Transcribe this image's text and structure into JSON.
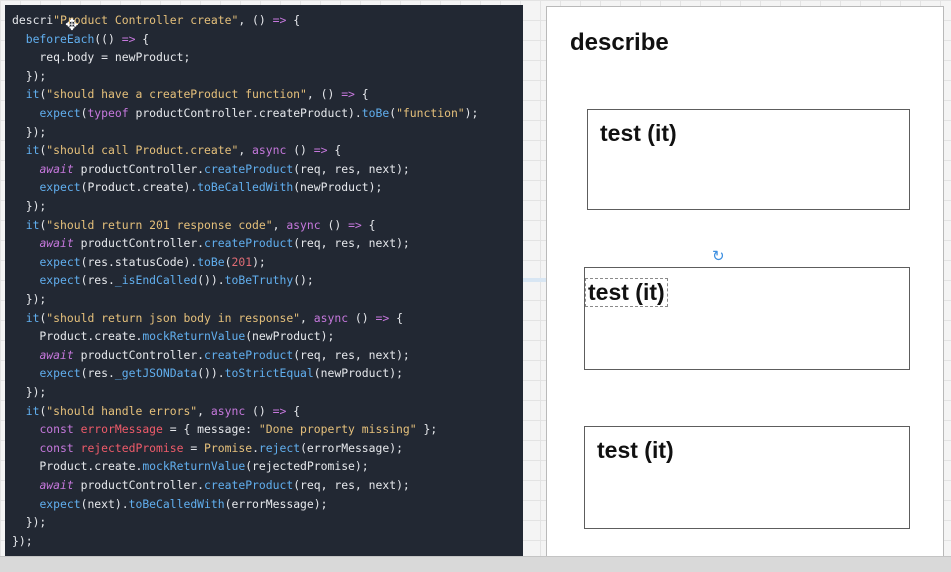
{
  "code": {
    "lines": [
      [
        [
          "pl",
          "descri"
        ],
        [
          "str",
          "\"Product Controller create\""
        ],
        [
          "pl",
          ", () "
        ],
        [
          "kw",
          "=>"
        ],
        [
          "pl",
          " {"
        ]
      ],
      [
        [
          "pl",
          "  "
        ],
        [
          "fn",
          "beforeEach"
        ],
        [
          "pl",
          "(() "
        ],
        [
          "kw",
          "=>"
        ],
        [
          "pl",
          " {"
        ]
      ],
      [
        [
          "pl",
          "    req.body = newProduct;"
        ]
      ],
      [
        [
          "pl",
          "  });"
        ]
      ],
      [
        [
          "pl",
          "  "
        ],
        [
          "fn",
          "it"
        ],
        [
          "pl",
          "("
        ],
        [
          "str",
          "\"should have a createProduct function\""
        ],
        [
          "pl",
          ", () "
        ],
        [
          "kw",
          "=>"
        ],
        [
          "pl",
          " {"
        ]
      ],
      [
        [
          "pl",
          "    "
        ],
        [
          "fn",
          "expect"
        ],
        [
          "pl",
          "("
        ],
        [
          "kw",
          "typeof"
        ],
        [
          "pl",
          " productController.createProduct)."
        ],
        [
          "fn",
          "toBe"
        ],
        [
          "pl",
          "("
        ],
        [
          "str",
          "\"function\""
        ],
        [
          "pl",
          ");"
        ]
      ],
      [
        [
          "pl",
          "  });"
        ]
      ],
      [
        [
          "pl",
          "  "
        ],
        [
          "fn",
          "it"
        ],
        [
          "pl",
          "("
        ],
        [
          "str",
          "\"should call Product.create\""
        ],
        [
          "pl",
          ", "
        ],
        [
          "kw",
          "async"
        ],
        [
          "pl",
          " () "
        ],
        [
          "kw",
          "=>"
        ],
        [
          "pl",
          " {"
        ]
      ],
      [
        [
          "pl",
          "    "
        ],
        [
          "ital",
          "await"
        ],
        [
          "pl",
          " productController."
        ],
        [
          "fn",
          "createProduct"
        ],
        [
          "pl",
          "(req, res, next);"
        ]
      ],
      [
        [
          "pl",
          "    "
        ],
        [
          "fn",
          "expect"
        ],
        [
          "pl",
          "(Product.create)."
        ],
        [
          "fn",
          "toBeCalledWith"
        ],
        [
          "pl",
          "(newProduct);"
        ]
      ],
      [
        [
          "pl",
          "  });"
        ]
      ],
      [
        [
          "pl",
          "  "
        ],
        [
          "fn",
          "it"
        ],
        [
          "pl",
          "("
        ],
        [
          "str",
          "\"should return 201 response code\""
        ],
        [
          "pl",
          ", "
        ],
        [
          "kw",
          "async"
        ],
        [
          "pl",
          " () "
        ],
        [
          "kw",
          "=>"
        ],
        [
          "pl",
          " {"
        ]
      ],
      [
        [
          "pl",
          "    "
        ],
        [
          "ital",
          "await"
        ],
        [
          "pl",
          " productController."
        ],
        [
          "fn",
          "createProduct"
        ],
        [
          "pl",
          "(req, res, next);"
        ]
      ],
      [
        [
          "pl",
          "    "
        ],
        [
          "fn",
          "expect"
        ],
        [
          "pl",
          "(res.statusCode)."
        ],
        [
          "fn",
          "toBe"
        ],
        [
          "pl",
          "("
        ],
        [
          "num",
          "201"
        ],
        [
          "pl",
          ");"
        ]
      ],
      [
        [
          "pl",
          "    "
        ],
        [
          "fn",
          "expect"
        ],
        [
          "pl",
          "(res."
        ],
        [
          "fn",
          "_isEndCalled"
        ],
        [
          "pl",
          "())."
        ],
        [
          "fn",
          "toBeTruthy"
        ],
        [
          "pl",
          "();"
        ]
      ],
      [
        [
          "pl",
          "  });"
        ]
      ],
      [
        [
          "pl",
          "  "
        ],
        [
          "fn",
          "it"
        ],
        [
          "pl",
          "("
        ],
        [
          "str",
          "\"should return json body in response\""
        ],
        [
          "pl",
          ", "
        ],
        [
          "kw",
          "async"
        ],
        [
          "pl",
          " () "
        ],
        [
          "kw",
          "=>"
        ],
        [
          "pl",
          " {"
        ]
      ],
      [
        [
          "pl",
          "    Product.create."
        ],
        [
          "fn",
          "mockReturnValue"
        ],
        [
          "pl",
          "(newProduct);"
        ]
      ],
      [
        [
          "pl",
          "    "
        ],
        [
          "ital",
          "await"
        ],
        [
          "pl",
          " productController."
        ],
        [
          "fn",
          "createProduct"
        ],
        [
          "pl",
          "(req, res, next);"
        ]
      ],
      [
        [
          "pl",
          "    "
        ],
        [
          "fn",
          "expect"
        ],
        [
          "pl",
          "(res."
        ],
        [
          "fn",
          "_getJSONData"
        ],
        [
          "pl",
          "())."
        ],
        [
          "fn",
          "toStrictEqual"
        ],
        [
          "pl",
          "(newProduct);"
        ]
      ],
      [
        [
          "pl",
          "  });"
        ]
      ],
      [
        [
          "pl",
          "  "
        ],
        [
          "fn",
          "it"
        ],
        [
          "pl",
          "("
        ],
        [
          "str",
          "\"should handle errors\""
        ],
        [
          "pl",
          ", "
        ],
        [
          "kw",
          "async"
        ],
        [
          "pl",
          " () "
        ],
        [
          "kw",
          "=>"
        ],
        [
          "pl",
          " {"
        ]
      ],
      [
        [
          "pl",
          "    "
        ],
        [
          "kw",
          "const"
        ],
        [
          "pl",
          " "
        ],
        [
          "var",
          "errorMessage"
        ],
        [
          "pl",
          " = { message: "
        ],
        [
          "str",
          "\"Done property missing\""
        ],
        [
          "pl",
          " };"
        ]
      ],
      [
        [
          "pl",
          "    "
        ],
        [
          "kw",
          "const"
        ],
        [
          "pl",
          " "
        ],
        [
          "var",
          "rejectedPromise"
        ],
        [
          "pl",
          " = "
        ],
        [
          "str",
          "Promise"
        ],
        [
          "pl",
          "."
        ],
        [
          "fn",
          "reject"
        ],
        [
          "pl",
          "(errorMessage);"
        ]
      ],
      [
        [
          "pl",
          "    Product.create."
        ],
        [
          "fn",
          "mockReturnValue"
        ],
        [
          "pl",
          "(rejectedPromise);"
        ]
      ],
      [
        [
          "pl",
          "    "
        ],
        [
          "ital",
          "await"
        ],
        [
          "pl",
          " productController."
        ],
        [
          "fn",
          "createProduct"
        ],
        [
          "pl",
          "(req, res, next);"
        ]
      ],
      [
        [
          "pl",
          "    "
        ],
        [
          "fn",
          "expect"
        ],
        [
          "pl",
          "(next)."
        ],
        [
          "fn",
          "toBeCalledWith"
        ],
        [
          "pl",
          "(errorMessage);"
        ]
      ],
      [
        [
          "pl",
          "  });"
        ]
      ],
      [
        [
          "pl",
          "});"
        ]
      ]
    ]
  },
  "diagram": {
    "title": "describe",
    "tests": [
      {
        "label": "test (it)"
      },
      {
        "label": "test (it)"
      },
      {
        "label": "test (it)"
      }
    ]
  },
  "icons": {
    "cursor": "move-cursor-icon",
    "rotate": "rotate-icon"
  },
  "colors": {
    "editor_bg": "#222833",
    "keyword": "#c678dd",
    "function": "#61afef",
    "string": "#e5c07b",
    "number": "#e06c75",
    "selection": "#3d8fe0"
  }
}
